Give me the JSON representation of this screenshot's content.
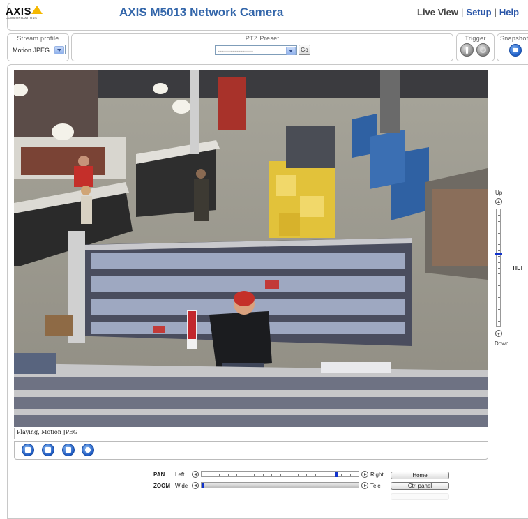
{
  "header": {
    "logo_text": "AXIS",
    "logo_subtext": "COMMUNICATIONS",
    "title": "AXIS M5013 Network Camera",
    "nav": [
      {
        "label": "Live View"
      },
      {
        "label": "Setup"
      },
      {
        "label": "Help"
      }
    ],
    "nav_separator": "|"
  },
  "controls": {
    "stream_profile": {
      "title": "Stream profile",
      "value": "Motion JPEG"
    },
    "ptz_preset": {
      "title": "PTZ Preset",
      "value": "-----------------",
      "go_label": "Go"
    },
    "trigger": {
      "title": "Trigger"
    },
    "snapshot": {
      "title": "Snapshot"
    }
  },
  "player": {
    "status": "Playing, Motion JPEG",
    "buttons": [
      "stop-icon",
      "snapshot-icon",
      "view-fullsize-icon",
      "record-icon"
    ]
  },
  "tilt": {
    "up_label": "Up",
    "down_label": "Down",
    "title": "TILT",
    "position": 0.38
  },
  "pan": {
    "title": "PAN",
    "left_label": "Left",
    "right_label": "Right",
    "position": 0.87
  },
  "zoom": {
    "title": "ZOOM",
    "wide_label": "Wide",
    "tele_label": "Tele",
    "position": 0.0
  },
  "panel_buttons": {
    "home": "Home",
    "ctrl_panel": "Ctrl panel"
  },
  "colors": {
    "title_blue": "#3366aa",
    "link_blue": "#2a56a8",
    "slider_knob": "#1133cc"
  }
}
